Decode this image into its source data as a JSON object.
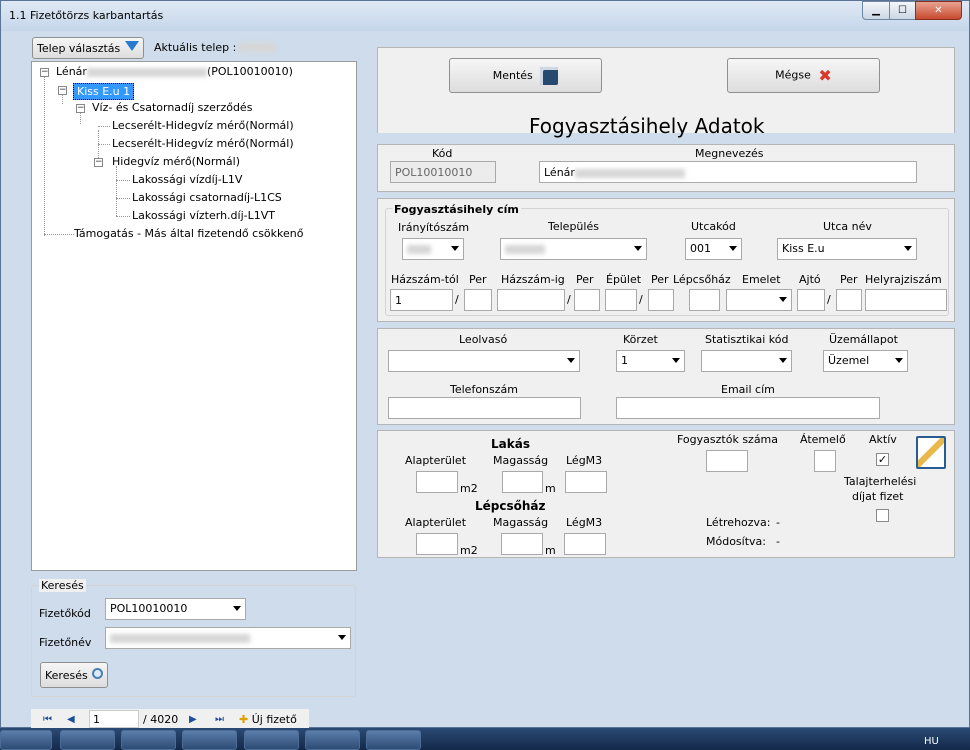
{
  "window": {
    "title": "1.1 Fizetőtörzs karbantartás",
    "min": "▁",
    "max": "☐",
    "close": "✕"
  },
  "left": {
    "telep_button": "Telep választás",
    "aktualis_telep_label": "Aktuális telep :",
    "tree": {
      "root": "Lénár",
      "root_code": "(POL10010010)",
      "selected": "Kiss E.u 1",
      "contract": "Víz- és Csatornadíj szerződés",
      "meter1": "Lecserélt-Hidegvíz mérő(Normál)",
      "meter2": "Lecserélt-Hidegvíz mérő(Normál)",
      "meter3": "Hidegvíz mérő(Normál)",
      "fee1": "Lakossági vízdíj-L1V",
      "fee2": "Lakossági csatornadíj-L1CS",
      "fee3": "Lakossági vízterh.díj-L1VT",
      "support": "Támogatás - Más által fizetendő csökkenő"
    },
    "search": {
      "group": "Keresés",
      "fizetokod_label": "Fizetőkód",
      "fizetokod_value": "POL10010010",
      "fizetonev_label": "Fizetőnév",
      "button": "Keresés"
    },
    "nav": {
      "position": "1",
      "total": "/ 4020",
      "new": "Új fizető"
    }
  },
  "right": {
    "save": "Mentés",
    "cancel": "Mégse",
    "heading": "Fogyasztásihely Adatok",
    "kod_label": "Kód",
    "kod_value": "POL10010010",
    "megnevezes_label": "Megnevezés",
    "megnevezes_value": "Lénár",
    "address": {
      "title": "Fogyasztásihely cím",
      "iranyitoszam": "Irányítószám",
      "telepules": "Település",
      "utcakod": "Utcakód",
      "utcakod_value": "001",
      "utcanev": "Utca név",
      "utcanev_value": "Kiss E.u",
      "hazszam_tol": "Házszám-tól",
      "per1": "Per",
      "hazszam_ig": "Házszám-ig",
      "per2": "Per",
      "epulet": "Épület",
      "per3": "Per",
      "lepcsohaz": "Lépcsőház",
      "emelet": "Emelet",
      "ajto": "Ajtó",
      "per4": "Per",
      "helyrajziszam": "Helyrajziszám",
      "hazszam_tol_value": "1",
      "slash": "/"
    },
    "misc": {
      "leolvaso": "Leolvasó",
      "korzet": "Körzet",
      "korzet_value": "1",
      "statisztikai": "Statisztikai kód",
      "uzemallapot": "Üzemállapot",
      "uzemallapot_value": "Üzemel",
      "telefonszam": "Telefonszám",
      "email": "Email cím"
    },
    "lakas": {
      "title": "Lakás",
      "alapterulet": "Alapterület",
      "magassag": "Magasság",
      "legm3": "LégM3",
      "m2": "m2",
      "m": "m",
      "lepcsohaz_title": "Lépcsőház",
      "alapterulet2": "Alapterület",
      "magassag2": "Magasság",
      "legm3_2": "LégM3",
      "m2_2": "m2",
      "m_2": "m",
      "fogyasztok": "Fogyasztók száma",
      "atemelo": "Átemelő",
      "aktiv": "Aktív",
      "aktiv_checked": "✓",
      "talaj": "Talajterhelési",
      "talaj2": "díjat fizet",
      "letrehozva": "Létrehozva:",
      "letrehozva_value": "-",
      "modositva": "Módosítva:",
      "modositva_value": "-"
    }
  },
  "taskbar": {
    "lang": "HU"
  }
}
